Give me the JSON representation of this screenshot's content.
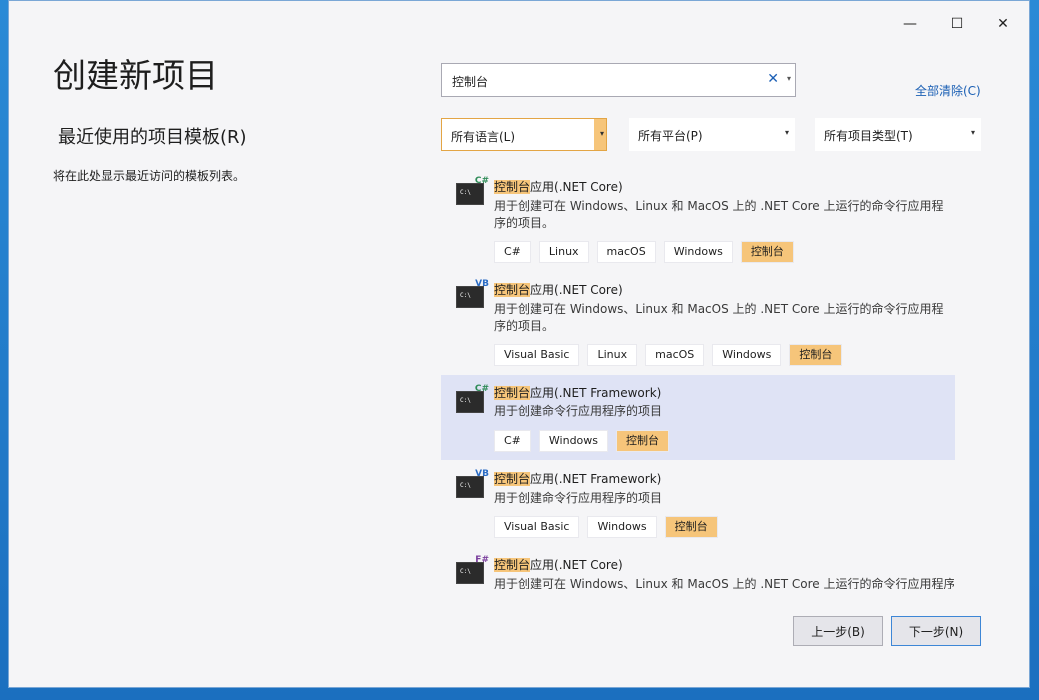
{
  "window": {
    "title": "创建新项目",
    "controls": {
      "minimize": "—",
      "maximize": "☐",
      "close": "✕"
    }
  },
  "recent": {
    "heading": "最近使用的项目模板(R)",
    "empty_note": "将在此处显示最近访问的模板列表。"
  },
  "search": {
    "value": "控制台",
    "clear_icon": "✕",
    "dropdown_icon": "▾"
  },
  "clear_all_link": "全部清除(C)",
  "filters": {
    "language": "所有语言(L)",
    "platform": "所有平台(P)",
    "project_type": "所有项目类型(T)",
    "arrow": "▾"
  },
  "templates": [
    {
      "icon": "csharp-console-icon",
      "lang_badge": "C#",
      "badge_color": "#2e8b57",
      "name_hl": "控制台",
      "name_rest": "应用(.NET Core)",
      "desc": "用于创建可在 Windows、Linux 和 MacOS 上的 .NET Core 上运行的命令行应用程序的项目。",
      "tags": [
        "C#",
        "Linux",
        "macOS",
        "Windows",
        "控制台"
      ]
    },
    {
      "icon": "vb-console-icon",
      "lang_badge": "VB",
      "badge_color": "#2b6cc4",
      "name_hl": "控制台",
      "name_rest": "应用(.NET Core)",
      "desc": "用于创建可在 Windows、Linux 和 MacOS 上的 .NET Core 上运行的命令行应用程序的项目。",
      "tags": [
        "Visual Basic",
        "Linux",
        "macOS",
        "Windows",
        "控制台"
      ]
    },
    {
      "icon": "csharp-console-icon",
      "lang_badge": "C#",
      "badge_color": "#2e8b57",
      "name_hl": "控制台",
      "name_rest": "应用(.NET Framework)",
      "desc": "用于创建命令行应用程序的项目",
      "tags": [
        "C#",
        "Windows",
        "控制台"
      ]
    },
    {
      "icon": "vb-console-icon",
      "lang_badge": "VB",
      "badge_color": "#2b6cc4",
      "name_hl": "控制台",
      "name_rest": "应用(.NET Framework)",
      "desc": "用于创建命令行应用程序的项目",
      "tags": [
        "Visual Basic",
        "Windows",
        "控制台"
      ]
    },
    {
      "icon": "fsharp-console-icon",
      "lang_badge": "F#",
      "badge_color": "#7a3e9d",
      "name_hl": "控制台",
      "name_rest": "应用(.NET Core)",
      "desc": "用于创建可在 Windows、Linux 和 MacOS 上的 .NET Core 上运行的命令行应用程序",
      "tags": []
    }
  ],
  "buttons": {
    "back": "上一步(B)",
    "next": "下一步(N)"
  },
  "console_glyph": "C:\\"
}
